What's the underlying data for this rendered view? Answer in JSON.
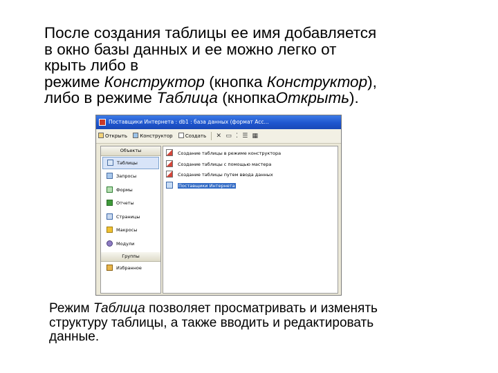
{
  "slide": {
    "line1": "После создания таблицы ее имя добавляется",
    "line2": "в окно базы данных и ее можно легко от",
    "line3": "крыть либо в",
    "line4_prefix": "режиме ",
    "line4_italic": "Конструктор",
    "line4_mid": " (кнопка ",
    "line4_italic2": "Конструктор",
    "line4_suffix": "),",
    "line5_prefix": "либо в режиме ",
    "line5_italic": "Таблица",
    "line5_mid": " (кнопка",
    "line5_italic2": "Открыть",
    "line5_suffix": ")."
  },
  "bottom": {
    "line1_prefix": "Режим ",
    "line1_italic": "Таблица",
    "line1_suffix": " позволяет просматривать и изменять",
    "line2": "структуру таблицы, а также вводить и редактировать",
    "line3": "данные."
  },
  "window": {
    "title": "Поставщики Интернета : db1 : база данных (формат Acc...",
    "toolbar": {
      "open_label": "Открыть",
      "design_label": "Конструктор",
      "create_label": "Создать",
      "delete_glyph": "✕"
    },
    "objects_header": "Объекты",
    "objects": [
      {
        "label": "Таблицы",
        "icon": "tables-icon"
      },
      {
        "label": "Запросы",
        "icon": "queries-icon"
      },
      {
        "label": "Формы",
        "icon": "forms-icon"
      },
      {
        "label": "Отчеты",
        "icon": "reports-icon"
      },
      {
        "label": "Страницы",
        "icon": "pages-icon"
      },
      {
        "label": "Макросы",
        "icon": "macros-icon"
      },
      {
        "label": "Модули",
        "icon": "modules-icon"
      }
    ],
    "groups_header": "Группы",
    "favorites_label": "Избранное",
    "list": [
      {
        "label": "Создание таблицы в режиме конструктора",
        "icon": "wizard-icon"
      },
      {
        "label": "Создание таблицы с помощью мастера",
        "icon": "wizard-icon"
      },
      {
        "label": "Создание таблицы путем ввода данных",
        "icon": "wizard-icon"
      },
      {
        "label": "Поставщики Интернета",
        "icon": "table-icon"
      }
    ]
  }
}
